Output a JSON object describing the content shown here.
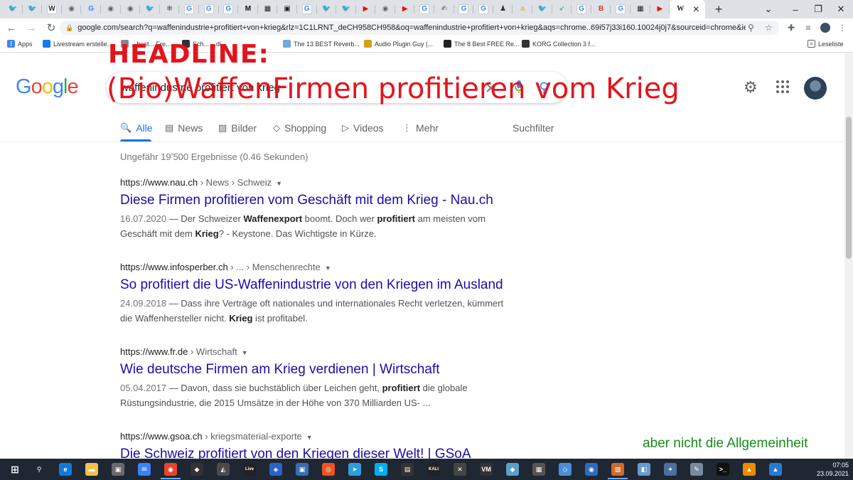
{
  "browser": {
    "tabs": [
      {
        "icon": "twitter-icon",
        "glyph": "🐦",
        "color": "#1d9bf0"
      },
      {
        "icon": "twitter-icon",
        "glyph": "🐦",
        "color": "#1d9bf0"
      },
      {
        "icon": "wikipedia-icon",
        "glyph": "W",
        "color": "#f4f4f4"
      },
      {
        "icon": "chrome-icon",
        "glyph": "◉",
        "color": "#5f6368"
      },
      {
        "icon": "translate-icon",
        "glyph": "G",
        "color": "#4285f4"
      },
      {
        "icon": "globe-icon",
        "glyph": "◉",
        "color": "#5f6368"
      },
      {
        "icon": "globe-icon",
        "glyph": "◉",
        "color": "#5f6368"
      },
      {
        "icon": "twitter-icon",
        "glyph": "🐦",
        "color": "#1d9bf0"
      },
      {
        "icon": "slack-icon",
        "glyph": "✻",
        "color": "#555555"
      },
      {
        "icon": "google-icon",
        "glyph": "G",
        "color": "#ffffff"
      },
      {
        "icon": "google-icon",
        "glyph": "G",
        "color": "#ffffff"
      },
      {
        "icon": "google-icon",
        "glyph": "G",
        "color": "#ffffff"
      },
      {
        "icon": "medium-icon",
        "glyph": "M",
        "color": "#111111"
      },
      {
        "icon": "pattern-icon",
        "glyph": "▦",
        "color": "#222222"
      },
      {
        "icon": "square-icon",
        "glyph": "▣",
        "color": "#222222"
      },
      {
        "icon": "google-icon",
        "glyph": "G",
        "color": "#ffffff"
      },
      {
        "icon": "twitter-icon",
        "glyph": "🐦",
        "color": "#1d9bf0"
      },
      {
        "icon": "twitter-icon",
        "glyph": "🐦",
        "color": "#1d9bf0"
      },
      {
        "icon": "youtube-icon",
        "glyph": "▶",
        "color": "#ff0000"
      },
      {
        "icon": "globe-icon",
        "glyph": "◉",
        "color": "#5f6368"
      },
      {
        "icon": "youtube-icon",
        "glyph": "▶",
        "color": "#ff0000"
      },
      {
        "icon": "google-icon",
        "glyph": "G",
        "color": "#ffffff"
      },
      {
        "icon": "signature-icon",
        "glyph": "✍",
        "color": "#444444"
      },
      {
        "icon": "google-icon",
        "glyph": "G",
        "color": "#ffffff"
      },
      {
        "icon": "google-icon",
        "glyph": "G",
        "color": "#ffffff"
      },
      {
        "icon": "figure-icon",
        "glyph": "♟",
        "color": "#333333"
      },
      {
        "icon": "amazon-icon",
        "glyph": "a",
        "color": "#f3a847"
      },
      {
        "icon": "twitter-icon",
        "glyph": "🐦",
        "color": "#1d9bf0"
      },
      {
        "icon": "feather-icon",
        "glyph": "➶",
        "color": "#3aa655"
      },
      {
        "icon": "google-icon",
        "glyph": "G",
        "color": "#ffffff"
      },
      {
        "icon": "b-icon",
        "glyph": "B",
        "color": "#d6352a"
      },
      {
        "icon": "google-icon",
        "glyph": "G",
        "color": "#ffffff"
      },
      {
        "icon": "pattern-icon",
        "glyph": "▦",
        "color": "#222222"
      },
      {
        "icon": "youtube-icon",
        "glyph": "▶",
        "color": "#ff0000"
      }
    ],
    "active_tab": {
      "icon": "wikipedia-icon",
      "glyph": "W",
      "close": "✕"
    },
    "new_tab": "+",
    "url": "google.com/search?q=waffenindustrie+profitiert+von+krieg&rlz=1C1LRNT_deCH958CH958&oq=waffenindustrie+profitiert+von+krieg&aqs=chrome..69i57j33i160.10024j0j7&sourceid=chrome&ie=U...",
    "bookmarks": [
      {
        "label": "Apps",
        "icon": "apps-icon",
        "color": "#4285f4"
      },
      {
        "label": "Livestream erstelle...",
        "icon": "facebook-icon",
        "color": "#1877f2"
      },
      {
        "label": "...best... Fre...",
        "icon": "bookmark-icon",
        "color": "#888888"
      },
      {
        "label": "Sch... ...di...",
        "icon": "wikipedia-icon",
        "color": "#333333"
      },
      {
        "label": "The 13 BEST Reverb...",
        "icon": "k-icon",
        "color": "#6fa8dc"
      },
      {
        "label": "Audio Plugin Guy |...",
        "icon": "plugin-icon",
        "color": "#d4a017"
      },
      {
        "label": "The 8 Best FREE Re...",
        "icon": "circle-icon",
        "color": "#222222"
      },
      {
        "label": "KORG Collection 3 f...",
        "icon": "korg-icon",
        "color": "#333333"
      }
    ],
    "reading_list": "Leseliste"
  },
  "google": {
    "logo": [
      "G",
      "o",
      "o",
      "g",
      "l",
      "e"
    ],
    "logo_colors": [
      "#4285f4",
      "#ea4335",
      "#fbbc05",
      "#4285f4",
      "#34a853",
      "#ea4335"
    ],
    "query": "waffenindustrie profitiert von krieg",
    "tabs": [
      {
        "label": "Alle",
        "glyph": "🔍"
      },
      {
        "label": "News",
        "glyph": "▤"
      },
      {
        "label": "Bilder",
        "glyph": "▨"
      },
      {
        "label": "Shopping",
        "glyph": "◇"
      },
      {
        "label": "Videos",
        "glyph": "▷"
      },
      {
        "label": "Mehr",
        "glyph": "⋮"
      }
    ],
    "filter": "Suchfilter",
    "stats": "Ungefähr 19’500 Ergebnisse (0.46 Sekunden)",
    "results": [
      {
        "cite": "https://www.nau.ch",
        "crumb": " › News › Schweiz",
        "title": "Diese Firmen profitieren vom Geschäft mit dem Krieg - Nau.ch",
        "date": "16.07.2020",
        "snippet_html": " — Der Schweizer <b>Waffenexport</b> boomt. Doch wer <b>profitiert</b> am meisten vom Geschäft mit dem <b>Krieg</b>? - Keystone. Das Wichtigste in Kürze."
      },
      {
        "cite": "https://www.infosperber.ch",
        "crumb": " › ... › Menschenrechte",
        "title": "So profitiert die US-Waffenindustrie von den Kriegen im Ausland",
        "date": "24.09.2018",
        "snippet_html": " — Dass ihre Verträge oft nationales und internationales Recht verletzen, kümmert die Waffenhersteller nicht. <b>Krieg</b> ist profitabel."
      },
      {
        "cite": "https://www.fr.de",
        "crumb": " › Wirtschaft",
        "title": "Wie deutsche Firmen am Krieg verdienen | Wirtschaft",
        "date": "05.04.2017",
        "snippet_html": " — Davon, dass sie buchstäblich über Leichen geht, <b>profitiert</b> die globale Rüstungsindustrie, die 2015 Umsätze in der Höhe von 370 Milliarden US- ..."
      },
      {
        "cite": "https://www.gsoa.ch",
        "crumb": " › kriegsmaterial-exporte",
        "title": "Die Schweiz profitiert von den Kriegen dieser Welt! | GSoA",
        "date": "",
        "snippet_html": ""
      }
    ]
  },
  "overlay": {
    "headline": "HEADLINE:",
    "subheadline": "(Bio)WaffenFirmen profitieren vom Krieg",
    "caption": "aber nicht die Allgemeinheit",
    "headline_color": "#e4141b",
    "caption_color": "#188a1e"
  },
  "taskbar": {
    "time": "07:05",
    "date": "23.09.2021",
    "apps": [
      {
        "icon": "windows-start-icon",
        "glyph": "⊞",
        "color": "#1f2733"
      },
      {
        "icon": "search-icon",
        "glyph": "⚲",
        "color": "#1f2733"
      },
      {
        "icon": "edge-icon",
        "glyph": "e",
        "color": "#0f7bd9"
      },
      {
        "icon": "file-explorer-icon",
        "glyph": "▬",
        "color": "#f2c14e"
      },
      {
        "icon": "store-icon",
        "glyph": "▣",
        "color": "#6a6a6a"
      },
      {
        "icon": "mail-icon",
        "glyph": "✉",
        "color": "#3b82f6"
      },
      {
        "icon": "chrome-icon",
        "glyph": "◉",
        "color": "#e6452f"
      },
      {
        "icon": "app-icon",
        "glyph": "◆",
        "color": "#333333"
      },
      {
        "icon": "app-icon",
        "glyph": "◭",
        "color": "#4a4a4a"
      },
      {
        "icon": "live-icon",
        "glyph": "Live",
        "color": "#222222"
      },
      {
        "icon": "app-icon",
        "glyph": "◈",
        "color": "#2a63c4"
      },
      {
        "icon": "app-icon",
        "glyph": "▣",
        "color": "#3a6fb0"
      },
      {
        "icon": "ubuntu-icon",
        "glyph": "◎",
        "color": "#e95420"
      },
      {
        "icon": "telegram-icon",
        "glyph": "➤",
        "color": "#2aa0da"
      },
      {
        "icon": "skype-icon",
        "glyph": "S",
        "color": "#00aff0"
      },
      {
        "icon": "terminal-icon",
        "glyph": "▤",
        "color": "#333333"
      },
      {
        "icon": "kali-icon",
        "glyph": "KALI",
        "color": "#222222"
      },
      {
        "icon": "tools-icon",
        "glyph": "✕",
        "color": "#444444"
      },
      {
        "icon": "voicemeeter-icon",
        "glyph": "VM",
        "color": "#333333"
      },
      {
        "icon": "app-icon",
        "glyph": "◆",
        "color": "#5aa0c8"
      },
      {
        "icon": "app-icon",
        "glyph": "▦",
        "color": "#555555"
      },
      {
        "icon": "app-icon",
        "glyph": "◇",
        "color": "#4a8fd8"
      },
      {
        "icon": "app-icon",
        "glyph": "◉",
        "color": "#2d6cc0"
      },
      {
        "icon": "app-icon",
        "glyph": "▨",
        "color": "#d06a2a"
      },
      {
        "icon": "app-icon",
        "glyph": "◧",
        "color": "#6a9ad0"
      },
      {
        "icon": "app-icon",
        "glyph": "✦",
        "color": "#4a6fa0"
      },
      {
        "icon": "notepad-icon",
        "glyph": "✎",
        "color": "#7a8aa0"
      },
      {
        "icon": "cmd-icon",
        "glyph": ">_",
        "color": "#111111"
      },
      {
        "icon": "vlc-icon",
        "glyph": "▲",
        "color": "#f08a00"
      },
      {
        "icon": "photos-icon",
        "glyph": "▲",
        "color": "#2a7ad0"
      }
    ]
  }
}
